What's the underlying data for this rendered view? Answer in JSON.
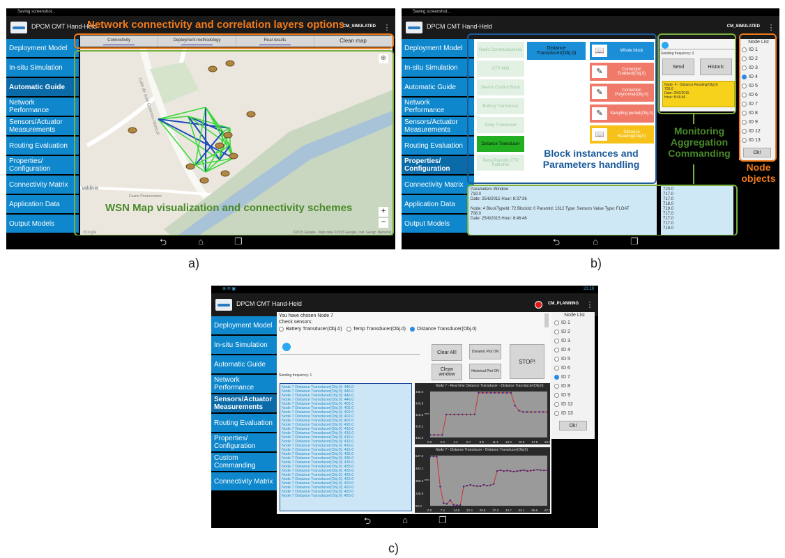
{
  "common": {
    "status_text": "Saving screenshot...",
    "app_title": "DPCM CMT Hand-Held",
    "menu_glyph": "⋮",
    "nav_icons": [
      "back-icon",
      "home-icon",
      "recent-apps-icon"
    ]
  },
  "panel_a": {
    "caption": "a)",
    "mode": "CM_SIMULATED",
    "annotation_title": "Network connectivity and correlation layers options",
    "annotation_map": "WSN Map visualization and connectivity schemes",
    "sidebar": [
      "Deployment Model",
      "In-situ Simulation",
      "Automatic Guide",
      "Network Performance",
      "Sensors/Actuator Measurements",
      "Routing Evaluation",
      "Properties/ Configuration",
      "Connectivity Matrix",
      "Application Data",
      "Output Models"
    ],
    "active_index": 2,
    "tabs": [
      "Connectivity",
      "Deployment methodology",
      "Real results",
      "Clean map"
    ],
    "map_labels": {
      "street1": "Calle de José Gutiérrez Abascal",
      "place": "Valdivia",
      "sub": "Cuarto Producciones",
      "attribution": "©2015 Google - Map data ©2015 Google, Inst. Geogr. Nacional",
      "google": "Google"
    },
    "zoom_in": "+",
    "zoom_out": "−"
  },
  "panel_b": {
    "caption": "b)",
    "mode": "CM_SIMULATED",
    "sidebar": [
      "Deployment Model",
      "In-situ Simulation",
      "Automatic Guide",
      "Network Performance",
      "Sensors/Actuator Measurements",
      "Routing Evaluation",
      "Properties/ Configuration",
      "Connectivity Matrix",
      "Application Data",
      "Output Models"
    ],
    "active_index": 6,
    "left_blocks": [
      "Radio Communications",
      "CTP Mlift",
      "Device Control Block",
      "Battery Transducer",
      "Temp Transducer",
      "Distance Transducer",
      "Temp Periodic CTP Publisher"
    ],
    "selected_block": "Distance Transducer(Obj.0)",
    "params": [
      "Whole block",
      "Correction Enabled(Obj.0)",
      "Correction Polynomial(Obj.0)",
      "Sampling period(Obj.0)",
      "Distance Reading(Obj.0)"
    ],
    "annotation_block": "Block instances and Parameters handling",
    "annotation_monitor": "Monitoring Aggregation Commanding",
    "annotation_nodes": "Node objects",
    "sending_freq": "Sending frequency: 0",
    "send": "Send",
    "historic": "Historic",
    "yellow_info": "Node: 4 - Distance Reading(Obj.0)\n709.0\nDate: 25/6/2015\nHour: 8:46:46",
    "param_window": "Parameters Window\n719.0\nDate: 25/6/2015 Hour: 8:37:36\n\nNode: 4 BlockTypeId: 72 BlockId: 0 ParamId: 1312 Type: Sensors Value Type: FLOAT\n708.0\nDate: 25/6/2015 Hour: 8:46:46",
    "values_col": "720.0\n717.0\n717.0\n718.0\n719.0\n717.0\n717.0\n717.0\n719.0",
    "node_list_title": "Node List",
    "nodes": [
      "ID 1",
      "ID 2",
      "ID 3",
      "ID 4",
      "ID 5",
      "ID 6",
      "ID 7",
      "ID 8",
      "ID 9",
      "ID 12",
      "ID 13"
    ],
    "selected_node": 3,
    "ok": "Ok!"
  },
  "panel_c": {
    "caption": "c)",
    "mode": "CM_PLANNING",
    "clock": "21:19",
    "sidebar": [
      "Deployment Model",
      "In-situ Simulation",
      "Automatic Guide",
      "Network Performance",
      "Sensors/Actuator Measurements",
      "Routing Evaluation",
      "Properties/ Configuration",
      "Custom Commanding",
      "Connectivity Matrix"
    ],
    "active_index": 4,
    "chosen": "You have chosen Node 7",
    "check_sensors": "Check sensors:",
    "sensors": [
      "Battery Transducer(Obj.0)",
      "Temp Transducer(Obj.0)",
      "Distance Transducer(Obj.0)"
    ],
    "sensor_selected": 2,
    "sending_freq": "Sending frequency: 1",
    "clear_all": "Clear All!",
    "clean_window": "Clean window",
    "dynamic_plot": "Dynamic Plot ON",
    "historical_plot": "Historical Plot ON",
    "stop": "STOP!",
    "log_lines": [
      "Node 7 Distance Transducer(Obj.0): 446.0",
      "Node 7 Distance Transducer(Obj.0): 446.0",
      "Node 7 Distance Transducer(Obj.0): 446.0",
      "Node 7 Distance Transducer(Obj.0): 446.0",
      "Node 7 Distance Transducer(Obj.0): 402.0",
      "Node 7 Distance Transducer(Obj.0): 402.0",
      "Node 7 Distance Transducer(Obj.0): 402.0",
      "Node 7 Distance Transducer(Obj.0): 402.0",
      "Node 7 Distance Transducer(Obj.0): 402.0",
      "Node 7 Distance Transducer(Obj.0): 416.0",
      "Node 7 Distance Transducer(Obj.0): 416.0",
      "Node 7 Distance Transducer(Obj.0): 416.0",
      "Node 7 Distance Transducer(Obj.0): 416.0",
      "Node 7 Distance Transducer(Obj.0): 416.0",
      "Node 7 Distance Transducer(Obj.0): 416.0",
      "Node 7 Distance Transducer(Obj.0): 416.0",
      "Node 7 Distance Transducer(Obj.0): 435.0",
      "Node 7 Distance Transducer(Obj.0): 435.0",
      "Node 7 Distance Transducer(Obj.0): 435.0",
      "Node 7 Distance Transducer(Obj.0): 435.0",
      "Node 7 Distance Transducer(Obj.0): 435.0",
      "Node 7 Distance Transducer(Obj.0): 425.0",
      "Node 7 Distance Transducer(Obj.0): 420.0",
      "Node 7 Distance Transducer(Obj.0): 420.0",
      "Node 7 Distance Transducer(Obj.0): 420.0",
      "Node 7 Distance Transducer(Obj.0): 420.0",
      "Node 7 Distance Transducer(Obj.0): 420.0"
    ],
    "plot1_title": "Node 7 - Real time Distance Transducer - Distance Transducer(Obj.0)",
    "plot2_title": "Node 7 - Distance Transducer - Distance Transducer(Obj.0)",
    "node_list_title": "Node List",
    "nodes": [
      "ID 1",
      "ID 2",
      "ID 3",
      "ID 4",
      "ID 5",
      "ID 6",
      "ID 7",
      "ID 8",
      "ID 9",
      "ID 12",
      "ID 13"
    ],
    "selected_node": 6,
    "ok": "Ok!"
  },
  "colors": {
    "sidebar": "#0e87cc",
    "sidebar_active": "#0b6aa8",
    "annot_orange": "#f07a1a",
    "annot_green": "#4a8a2a",
    "annot_blue": "#1a5a9a",
    "plot_line": "#d03030"
  },
  "chart_data": [
    {
      "type": "line",
      "title": "Node 7 - Real time Distance Transducer - Distance Transducer(Obj.0)",
      "x": [
        0,
        2.2,
        4.4,
        6.7,
        8.9,
        11.1,
        13.3,
        15.6,
        17.8,
        20.0
      ],
      "xticks": [
        "0.0",
        "2.2",
        "4.4",
        "6.7",
        "8.9",
        "11.1",
        "13.3",
        "15.6",
        "17.8",
        "20.0"
      ],
      "yticks": [
        "402.0",
        "410.2",
        "418.5",
        "426.8",
        "435.0"
      ],
      "ylabel": "mm",
      "ylim": [
        400,
        436
      ],
      "series": [
        {
          "values": [
            402,
            402,
            402,
            402,
            418,
            418,
            418,
            418,
            418,
            418,
            418,
            418,
            435,
            435,
            435,
            435,
            435,
            435,
            435,
            435,
            435,
            425,
            421,
            420,
            420,
            420,
            420,
            420,
            420,
            420
          ]
        }
      ]
    },
    {
      "type": "line",
      "title": "Node 7 - Distance Transducer - Distance Transducer(Obj.0)",
      "xticks": [
        "0.0",
        "7.4",
        "14.8",
        "22.3",
        "29.8",
        "37.2",
        "44.7",
        "52.1",
        "59.6",
        "67.0"
      ],
      "yticks": [
        "92.0",
        "225.8",
        "359.5",
        "493.2",
        "627.0"
      ],
      "ylabel": "mm",
      "ylim": [
        90,
        640
      ],
      "series": [
        {
          "values": [
            630,
            630,
            628,
            300,
            120,
            110,
            150,
            100,
            95,
            96,
            300,
            310,
            320,
            310,
            305,
            305,
            320,
            310,
            315,
            330,
            470,
            480,
            470,
            475,
            470,
            465,
            470,
            475,
            480,
            470,
            475,
            480,
            485,
            480,
            478,
            480
          ]
        }
      ]
    }
  ]
}
